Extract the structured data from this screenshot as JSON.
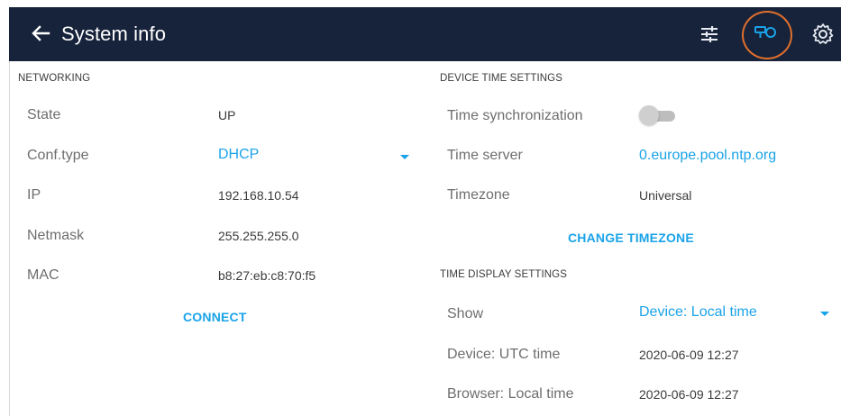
{
  "header": {
    "title": "System info",
    "icons": [
      "back-arrow-icon",
      "sliders-icon",
      "device-link-icon",
      "gear-icon"
    ]
  },
  "networking": {
    "section_title": "NETWORKING",
    "rows": [
      {
        "label": "State",
        "value": "UP"
      },
      {
        "label": "Conf.type",
        "value": "DHCP"
      },
      {
        "label": "IP",
        "value": "192.168.10.54"
      },
      {
        "label": "Netmask",
        "value": "255.255.255.0"
      },
      {
        "label": "MAC",
        "value": "b8:27:eb:c8:70:f5"
      }
    ],
    "connect_label": "CONNECT"
  },
  "device_time": {
    "section_title": "DEVICE TIME SETTINGS",
    "sync_label": "Time synchronization",
    "sync_enabled": false,
    "server_label": "Time server",
    "server_value": "0.europe.pool.ntp.org",
    "timezone_label": "Timezone",
    "timezone_value": "Universal",
    "change_timezone_label": "CHANGE TIMEZONE"
  },
  "time_display": {
    "section_title": "TIME DISPLAY SETTINGS",
    "show_label": "Show",
    "show_value": "Device: Local time",
    "rows": [
      {
        "label": "Device: UTC time",
        "value": "2020-06-09 12:27"
      },
      {
        "label": "Browser: Local time",
        "value": "2020-06-09 12:27"
      }
    ]
  },
  "colors": {
    "topbar": "#17233a",
    "accent": "#1aa3e8",
    "highlight": "#e06f2c"
  }
}
